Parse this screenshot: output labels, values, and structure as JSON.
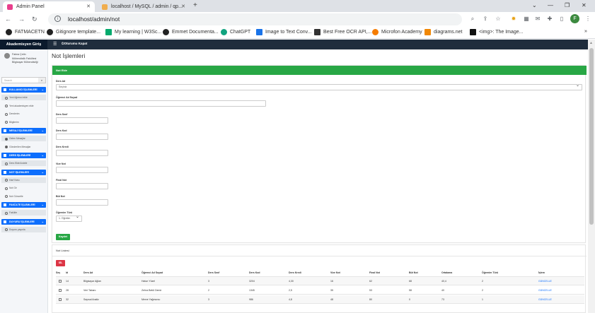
{
  "browser": {
    "tabs": [
      {
        "title": "Admin Panel",
        "active": true,
        "icon_color": "#e83e8c"
      },
      {
        "title": "localhost / MySQL / admin / qp...",
        "active": false,
        "icon_color": "#f0ad4e"
      }
    ],
    "new_tab_label": "+",
    "url": "localhost/admin/not",
    "profile_initial": "F",
    "bookmarks": [
      {
        "label": "FATMACETN",
        "icon": "github-icon"
      },
      {
        "label": "Gitignore template...",
        "icon": "github-icon"
      },
      {
        "label": "My learning | W3Sc...",
        "icon": "w3schools-icon"
      },
      {
        "label": "Emmet Documenta...",
        "icon": "emmet-icon"
      },
      {
        "label": "ChatGPT",
        "icon": "chatgpt-icon"
      },
      {
        "label": "Image to Text Conv...",
        "icon": "image-icon"
      },
      {
        "label": "Best Free OCR API,...",
        "icon": "ocr-icon"
      },
      {
        "label": "Microfon Academy",
        "icon": "microfon-icon"
      },
      {
        "label": "diagrams.net",
        "icon": "diagrams-icon"
      },
      {
        "label": "<img>: The Image...",
        "icon": "mdn-icon"
      }
    ]
  },
  "app": {
    "brand": "Akademisyen Giriş",
    "logout_label": "Oturumu Kapat",
    "user_name": "Fatma Çetin",
    "user_faculty": "Mühendislik Fakültesi",
    "user_department": "Bilgisayar Mühendisliği",
    "search_placeholder": "Search",
    "sidebar": [
      {
        "type": "section",
        "label": "KULLANICI İŞLEMLERİ"
      },
      {
        "type": "item",
        "label": "Yeni öğrenci ekle",
        "selected": true
      },
      {
        "type": "item",
        "label": "Yeni akademisyen ekle"
      },
      {
        "type": "item",
        "label": "Derslerim"
      },
      {
        "type": "item",
        "label": "Bilgilerim"
      },
      {
        "type": "section",
        "label": "MESAJ İŞLEMLERİ"
      },
      {
        "type": "item",
        "label": "Gelen Mesajlar",
        "selected": true,
        "filled": true
      },
      {
        "type": "item",
        "label": "Gönderilen Mesajlar",
        "filled": true
      },
      {
        "type": "section",
        "label": "DERS İŞLEMLERİ"
      },
      {
        "type": "item",
        "label": "Ders Ekle/Listele",
        "selected": true
      },
      {
        "type": "section",
        "label": "NOT İŞLEMLERİ"
      },
      {
        "type": "item",
        "label": "Harf Notu",
        "selected": true
      },
      {
        "type": "item",
        "label": "Not Gir"
      },
      {
        "type": "item",
        "label": "Not Güncelle"
      },
      {
        "type": "section",
        "label": "FAKÜLTE İŞLEMLERİ"
      },
      {
        "type": "item",
        "label": "Fakülte",
        "selected": true
      },
      {
        "type": "section",
        "label": "DUYURU İŞLEMLERİ"
      },
      {
        "type": "item",
        "label": "Duyuru yayınla",
        "selected": true
      }
    ],
    "page_title": "Not İşlemleri",
    "form": {
      "header": "Not Ekle",
      "fields": [
        {
          "label": "Ders Ad",
          "value": "Seçiniz",
          "kind": "select",
          "wide": "full"
        },
        {
          "label": "Öğrenci Ad Soyad",
          "value": "",
          "kind": "input",
          "wide": "half"
        },
        {
          "label": "Ders Sınıf",
          "value": "",
          "kind": "input",
          "wide": "small"
        },
        {
          "label": "Ders Kod",
          "value": "",
          "kind": "input",
          "wide": "small"
        },
        {
          "label": "Ders Kredi",
          "value": "",
          "kind": "input",
          "wide": "small"
        },
        {
          "label": "Vize Not",
          "value": "",
          "kind": "input",
          "wide": "small"
        },
        {
          "label": "Final Not",
          "value": "",
          "kind": "input",
          "wide": "small"
        },
        {
          "label": "Büt Not",
          "value": "",
          "kind": "input",
          "wide": "small"
        },
        {
          "label": "Öğrenim Türü",
          "value": "1. Öğretim",
          "kind": "select",
          "wide": "tiny"
        }
      ],
      "save_label": "Kaydet"
    },
    "list": {
      "title": "Not Listesi",
      "delete_label": "SİL",
      "columns": [
        "Seç",
        "Id",
        "Ders Ad",
        "Öğrenci Ad Soyad",
        "Ders Sınıf",
        "Ders Kod",
        "Ders Kredi",
        "Vize Not",
        "Final Not",
        "Büt Not",
        "Ortalama",
        "Öğrenim Türü",
        "İşlem"
      ],
      "rows": [
        [
          "",
          "14",
          "Bilgisayar Ağları",
          "Hatun Yüzel",
          "3",
          "3204",
          "4,30",
          "16",
          "62",
          "68",
          "40,4",
          "2",
          "GÜNCELLE"
        ],
        [
          "",
          "28",
          "Veri Tabanı",
          "Zehra Betül Demir",
          "2",
          "1345",
          "2,5",
          "35",
          "53",
          "58",
          "40",
          "2",
          "GÜNCELLE"
        ],
        [
          "",
          "32",
          "Sayısal Analiz",
          "Merve Yağmurcu",
          "3",
          "986",
          "4,8",
          "48",
          "80",
          "0",
          "73",
          "1",
          "GÜNCELLE"
        ]
      ]
    }
  }
}
